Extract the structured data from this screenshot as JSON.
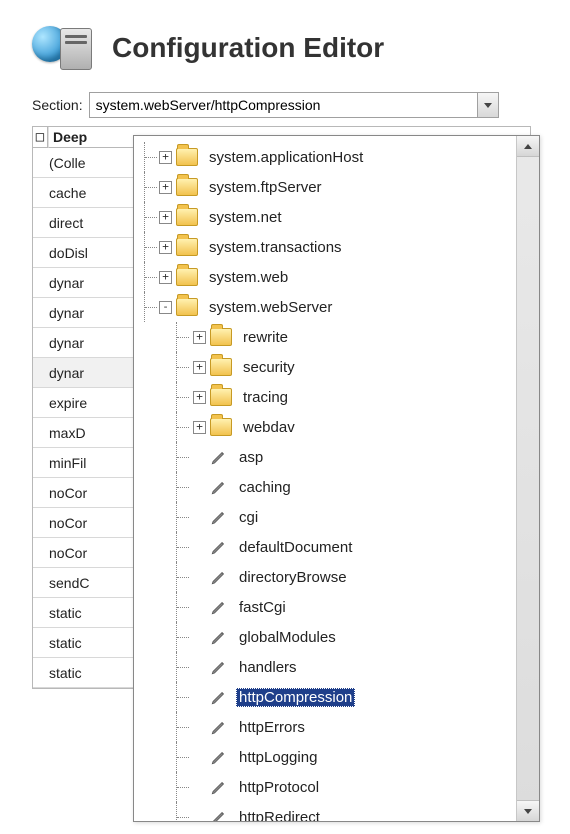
{
  "header": {
    "title": "Configuration Editor"
  },
  "section": {
    "label": "Section:",
    "value": "system.webServer/httpCompression"
  },
  "grid": {
    "category": "Deep",
    "rows": [
      "(Colle",
      "cache",
      "direct",
      "doDisl",
      "dynar",
      "dynar",
      "dynar",
      "dynar",
      "expire",
      "maxD",
      "minFil",
      "noCor",
      "noCor",
      "noCor",
      "sendC",
      "static",
      "static",
      "static"
    ]
  },
  "tree": [
    {
      "depth": 1,
      "kind": "folder",
      "expander": "+",
      "label": "system.applicationHost"
    },
    {
      "depth": 1,
      "kind": "folder",
      "expander": "+",
      "label": "system.ftpServer"
    },
    {
      "depth": 1,
      "kind": "folder",
      "expander": "+",
      "label": "system.net"
    },
    {
      "depth": 1,
      "kind": "folder",
      "expander": "+",
      "label": "system.transactions"
    },
    {
      "depth": 1,
      "kind": "folder",
      "expander": "+",
      "label": "system.web"
    },
    {
      "depth": 1,
      "kind": "folder",
      "expander": "-",
      "label": "system.webServer"
    },
    {
      "depth": 2,
      "kind": "folder",
      "expander": "+",
      "label": "rewrite"
    },
    {
      "depth": 2,
      "kind": "folder",
      "expander": "+",
      "label": "security"
    },
    {
      "depth": 2,
      "kind": "folder",
      "expander": "+",
      "label": "tracing"
    },
    {
      "depth": 2,
      "kind": "folder",
      "expander": "+",
      "label": "webdav"
    },
    {
      "depth": 2,
      "kind": "leaf",
      "label": "asp"
    },
    {
      "depth": 2,
      "kind": "leaf",
      "label": "caching"
    },
    {
      "depth": 2,
      "kind": "leaf",
      "label": "cgi"
    },
    {
      "depth": 2,
      "kind": "leaf",
      "label": "defaultDocument"
    },
    {
      "depth": 2,
      "kind": "leaf",
      "label": "directoryBrowse"
    },
    {
      "depth": 2,
      "kind": "leaf",
      "label": "fastCgi"
    },
    {
      "depth": 2,
      "kind": "leaf",
      "label": "globalModules"
    },
    {
      "depth": 2,
      "kind": "leaf",
      "label": "handlers"
    },
    {
      "depth": 2,
      "kind": "leaf",
      "label": "httpCompression",
      "selected": true
    },
    {
      "depth": 2,
      "kind": "leaf",
      "label": "httpErrors"
    },
    {
      "depth": 2,
      "kind": "leaf",
      "label": "httpLogging"
    },
    {
      "depth": 2,
      "kind": "leaf",
      "label": "httpProtocol"
    },
    {
      "depth": 2,
      "kind": "leaf",
      "label": "httpRedirect"
    }
  ]
}
